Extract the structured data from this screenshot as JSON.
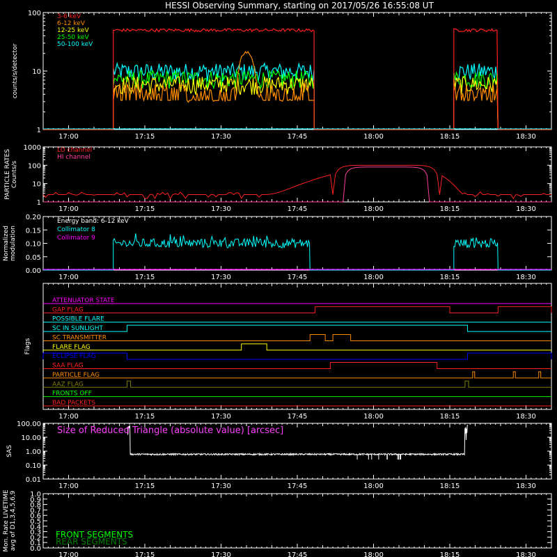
{
  "title": "HESSI Observing Summary, starting on 2017/05/26 16:55:08 UT",
  "time_axis": {
    "ticks": [
      "17:00",
      "17:15",
      "17:30",
      "17:45",
      "18:00",
      "18:15",
      "18:30"
    ],
    "tick_minutes_from_1700": [
      0,
      15,
      30,
      45,
      60,
      75,
      90
    ],
    "range_minutes_from_1700": [
      -5,
      95
    ]
  },
  "chart_data": [
    {
      "type": "line",
      "panel": "count_rates",
      "ylabel": "counts/s/detector",
      "yscale": "log",
      "ylim": [
        1,
        100
      ],
      "yticks": [
        "1",
        "10",
        "100"
      ],
      "observing_intervals_minutes": [
        [
          8.8,
          48.3
        ],
        [
          75.8,
          84.5
        ]
      ],
      "series": [
        {
          "name": "3-6 keV",
          "color": "#ff2020",
          "level": 50,
          "flare_bump": false
        },
        {
          "name": "6-12 keV",
          "color": "#ff8c00",
          "level": 4.5,
          "flare_bump": true,
          "flare_peak": 20,
          "flare_minutes": [
            33,
            37
          ]
        },
        {
          "name": "12-25 keV",
          "color": "#ffff00",
          "level": 6,
          "flare_bump": false
        },
        {
          "name": "25-50 keV",
          "color": "#00ff00",
          "level": 7.5,
          "flare_bump": false
        },
        {
          "name": "50-100 keV",
          "color": "#00ffff",
          "level": 10,
          "flare_bump": false
        }
      ]
    },
    {
      "type": "line",
      "panel": "particle_rates",
      "ylabel": "PARTICLE RATES\nCounts/s",
      "ylabel_lines": [
        "PARTICLE RATES",
        "Counts/s"
      ],
      "yscale": "log",
      "ylim": [
        1,
        1000
      ],
      "yticks": [
        "1",
        "10",
        "100",
        "1000"
      ],
      "series": [
        {
          "name": "LO channel",
          "color": "#ff2020",
          "baseline": 2.5,
          "peak": 100,
          "saa_minutes": [
            52,
            73
          ]
        },
        {
          "name": "HI channel",
          "color": "#ff40a0",
          "baseline": 1,
          "peak": 80,
          "saa_minutes": [
            54,
            71
          ]
        }
      ]
    },
    {
      "type": "line",
      "panel": "modulation",
      "ylabel": "Normalized\nmodulation",
      "ylabel_lines": [
        "Normalized",
        "modulation"
      ],
      "ylim": [
        0,
        0.2
      ],
      "yticks": [
        "0.00",
        "0.05",
        "0.10",
        "0.15",
        "0.20"
      ],
      "energy_band": "Energy band: 6-12 keV",
      "series": [
        {
          "name": "Collimator 8",
          "color": "#00ffff",
          "level": 0.1,
          "intervals": [
            [
              8.8,
              47.5
            ],
            [
              75.8,
              84.5
            ]
          ]
        },
        {
          "name": "Collimator 9",
          "color": "#ff00ff",
          "level": 0.0
        }
      ]
    },
    {
      "type": "line",
      "panel": "flags",
      "ylabel": "Flags",
      "flags": [
        {
          "name": "ATTENUATOR STATE",
          "color": "#ff00ff",
          "segments": []
        },
        {
          "name": "GAP FLAG",
          "color": "#ff2020",
          "segments": [
            [
              48.5,
              75.0
            ],
            [
              84.5,
              95
            ]
          ]
        },
        {
          "name": "POSSIBLE FLARE",
          "color": "#00ffff",
          "segments": []
        },
        {
          "name": "SC IN SUNLIGHT",
          "color": "#00ffff",
          "segments": [
            [
              11.5,
              78.5
            ]
          ]
        },
        {
          "name": "SC TRANSMITTER",
          "color": "#ff8c00",
          "segments": [
            [
              47.5,
              50.5
            ],
            [
              52,
              55.5
            ]
          ]
        },
        {
          "name": "FLARE FLAG",
          "color": "#ffff00",
          "segments": [
            [
              34,
              39
            ]
          ]
        },
        {
          "name": "ECLIPSE FLAG",
          "color": "#0000ff",
          "segments": [
            [
              -5,
              11.5
            ],
            [
              78.5,
              95
            ]
          ]
        },
        {
          "name": "SAA FLAG",
          "color": "#ff2020",
          "segments": [
            [
              51.5,
              72.5
            ]
          ]
        },
        {
          "name": "PARTICLE FLAG",
          "color": "#ff8c00",
          "segments": [
            [
              79.5,
              79.9
            ],
            [
              87.5,
              87.9
            ],
            [
              92.5,
              92.9
            ]
          ]
        },
        {
          "name": "AAZ FLAG",
          "color": "#808000",
          "segments": [
            [
              11.5,
              12.2
            ],
            [
              78,
              78.7
            ]
          ]
        },
        {
          "name": "FRONTS OFF",
          "color": "#00ff00",
          "segments": []
        },
        {
          "name": "BAD PACKETS",
          "color": "#ff2020",
          "segments": []
        }
      ]
    },
    {
      "type": "line",
      "panel": "sas",
      "ylabel": "SAS",
      "yscale": "log",
      "ylim": [
        0.01,
        100
      ],
      "yticks": [
        "0.01",
        "0.10",
        "1.00",
        "10.00",
        "100.00"
      ],
      "annotation": "Size of Reduced Triangle (absolute value) [arcsec]",
      "series": [
        {
          "name": "Reduced Triangle",
          "color": "#ffffff",
          "level": 0.6,
          "interval": [
            11.5,
            78.5
          ]
        }
      ]
    },
    {
      "type": "line",
      "panel": "livetime",
      "ylabel": "Mon. Rate LIVETIME\navg of D1,3,4,5,6,9",
      "ylabel_lines": [
        "Mon. Rate LIVETIME",
        "avg of D1,3,4,5,6,9"
      ],
      "ylim": [
        0,
        1
      ],
      "yticks": [
        "0.0",
        "0.1",
        "0.2",
        "0.3",
        "0.4",
        "0.5",
        "0.6",
        "0.7",
        "0.8",
        "0.9",
        "1.0"
      ],
      "series": [
        {
          "name": "FRONT SEGMENTS",
          "color": "#00ff00"
        },
        {
          "name": "REAR SEGMENTS",
          "color": "#008000"
        }
      ]
    }
  ]
}
